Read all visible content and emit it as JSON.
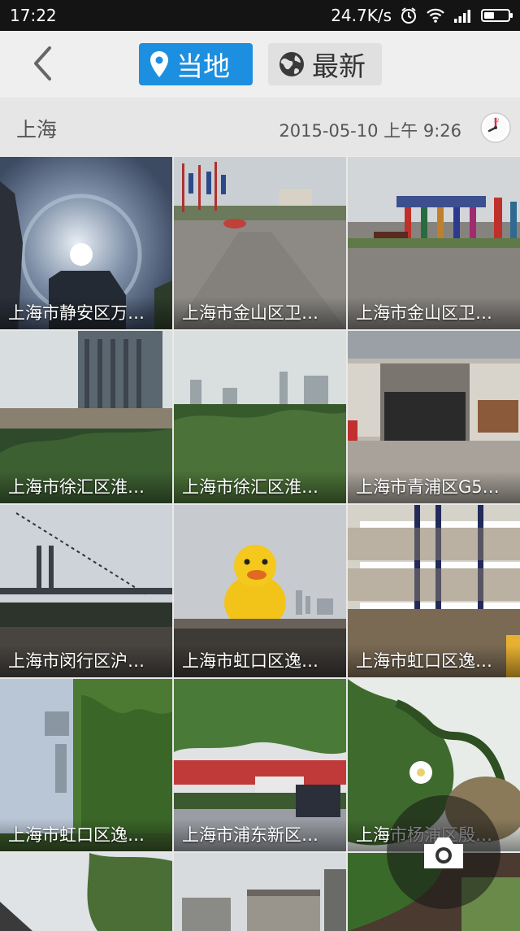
{
  "status": {
    "time": "17:22",
    "speed": "24.7K/s"
  },
  "header": {
    "local_label": "当地",
    "latest_label": "最新"
  },
  "info": {
    "city": "上海",
    "datetime": "2015-05-10  上午 9:26"
  },
  "photos": [
    {
      "caption": "上海市静安区万…"
    },
    {
      "caption": "上海市金山区卫…"
    },
    {
      "caption": "上海市金山区卫…"
    },
    {
      "caption": "上海市徐汇区淮…"
    },
    {
      "caption": "上海市徐汇区淮…"
    },
    {
      "caption": "上海市青浦区G5…"
    },
    {
      "caption": "上海市闵行区沪…"
    },
    {
      "caption": "上海市虹口区逸…"
    },
    {
      "caption": "上海市虹口区逸…"
    },
    {
      "caption": "上海市虹口区逸…"
    },
    {
      "caption": "上海市浦东新区…"
    },
    {
      "caption": "上海市杨浦区殷…"
    }
  ],
  "colors": {
    "accent": "#1d8fe0"
  },
  "icons": {
    "back": "chevron-left-icon",
    "location": "location-pin-icon",
    "globe": "globe-icon",
    "clock": "clock-icon",
    "camera": "camera-icon"
  }
}
